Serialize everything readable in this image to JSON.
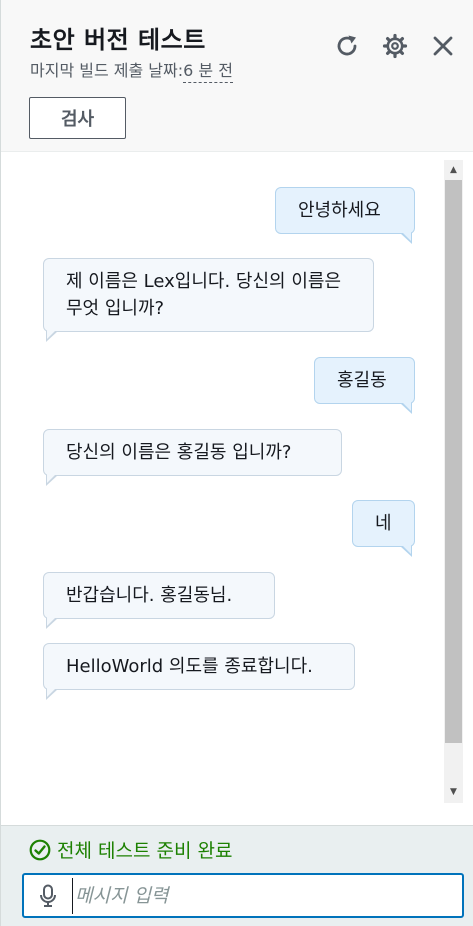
{
  "header": {
    "title": "초안 버전 테스트",
    "subtitle_prefix": "마지막 빌드 제출 날짜:",
    "subtitle_time": "6 분 전",
    "inspect_label": "검사",
    "icons": [
      "refresh-icon",
      "settings-icon",
      "close-icon"
    ]
  },
  "messages": [
    {
      "role": "user",
      "text": "안녕하세요"
    },
    {
      "role": "bot",
      "text": "제 이름은 Lex입니다. 당신의 이름은 무엇 입니까?"
    },
    {
      "role": "user",
      "text": "홍길동"
    },
    {
      "role": "bot",
      "text": "당신의 이름은 홍길동 입니까?"
    },
    {
      "role": "user",
      "text": "네"
    },
    {
      "role": "bot",
      "text": "반갑습니다. 홍길동님."
    },
    {
      "role": "bot",
      "text": "HelloWorld 의도를 종료합니다."
    }
  ],
  "footer": {
    "status_text": "전체 테스트 준비 완료",
    "input_placeholder": "메시지 입력",
    "input_value": ""
  },
  "colors": {
    "status_green": "#1d8102",
    "input_border": "#0073bb",
    "user_bubble": "#e5f2fd",
    "bot_bubble": "#f4f8fc"
  }
}
